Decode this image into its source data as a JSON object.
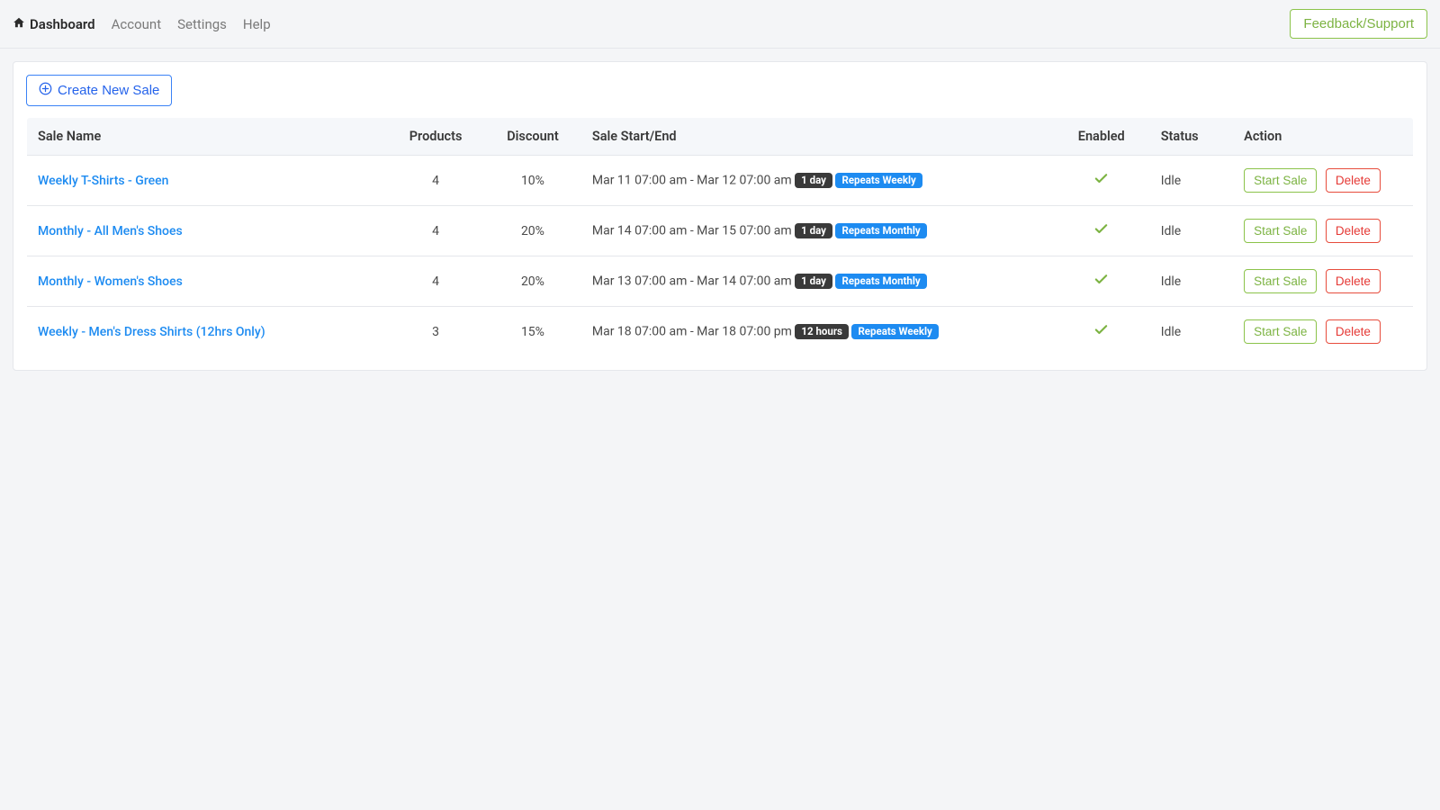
{
  "nav": {
    "dashboard": "Dashboard",
    "account": "Account",
    "settings": "Settings",
    "help": "Help"
  },
  "feedback_label": "Feedback/Support",
  "create_label": "Create New Sale",
  "columns": {
    "name": "Sale Name",
    "products": "Products",
    "discount": "Discount",
    "startend": "Sale Start/End",
    "enabled": "Enabled",
    "status": "Status",
    "action": "Action"
  },
  "action_labels": {
    "start": "Start Sale",
    "delete": "Delete"
  },
  "sales": [
    {
      "name": "Weekly T-Shirts - Green",
      "products": "4",
      "discount": "10%",
      "range": "Mar 11 07:00 am - Mar 12 07:00 am",
      "duration": "1 day",
      "repeat": "Repeats Weekly",
      "status": "Idle"
    },
    {
      "name": "Monthly - All Men's Shoes",
      "products": "4",
      "discount": "20%",
      "range": "Mar 14 07:00 am - Mar 15 07:00 am",
      "duration": "1 day",
      "repeat": "Repeats Monthly",
      "status": "Idle"
    },
    {
      "name": "Monthly - Women's Shoes",
      "products": "4",
      "discount": "20%",
      "range": "Mar 13 07:00 am - Mar 14 07:00 am",
      "duration": "1 day",
      "repeat": "Repeats Monthly",
      "status": "Idle"
    },
    {
      "name": "Weekly - Men's Dress Shirts (12hrs Only)",
      "products": "3",
      "discount": "15%",
      "range": "Mar 18 07:00 am - Mar 18 07:00 pm",
      "duration": "12 hours",
      "repeat": "Repeats Weekly",
      "status": "Idle"
    }
  ]
}
